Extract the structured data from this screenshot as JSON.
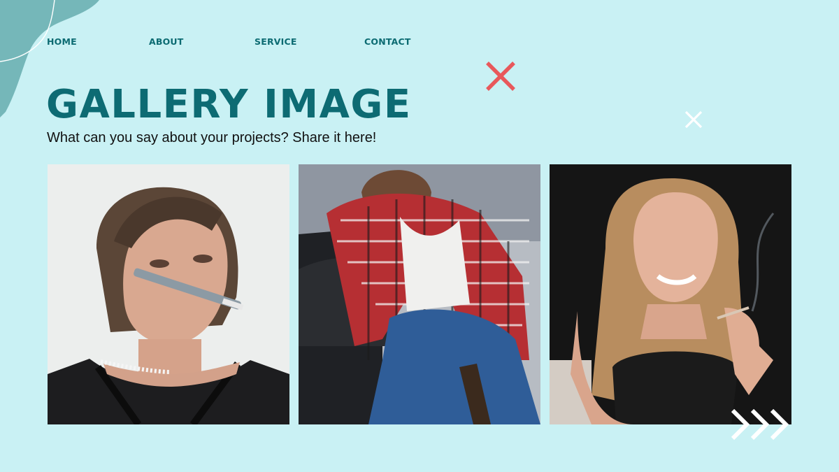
{
  "nav": {
    "items": [
      {
        "id": "home",
        "label": "HOME"
      },
      {
        "id": "about",
        "label": "ABOUT"
      },
      {
        "id": "service",
        "label": "SERVICE"
      },
      {
        "id": "contact",
        "label": "CONTACT"
      }
    ]
  },
  "hero": {
    "title": "GALLERY IMAGE",
    "subtitle": "What can you say about your projects? Share it here!"
  },
  "gallery": {
    "photos": [
      {
        "id": "photo-1",
        "alt": "Woman with syringe in mouth"
      },
      {
        "id": "photo-2",
        "alt": "Man asleep on couch holding bottle"
      },
      {
        "id": "photo-3",
        "alt": "Smiling woman holding a cigarette"
      }
    ]
  },
  "colors": {
    "background": "#c9f1f4",
    "accent_dark_teal": "#0d6b73",
    "accent_red": "#e8585b",
    "decoration_white": "#ffffff",
    "blob_teal": "#6fb3b6"
  },
  "icons": [
    "corner-blob-shape",
    "close-icon",
    "chevron-right-icon"
  ]
}
